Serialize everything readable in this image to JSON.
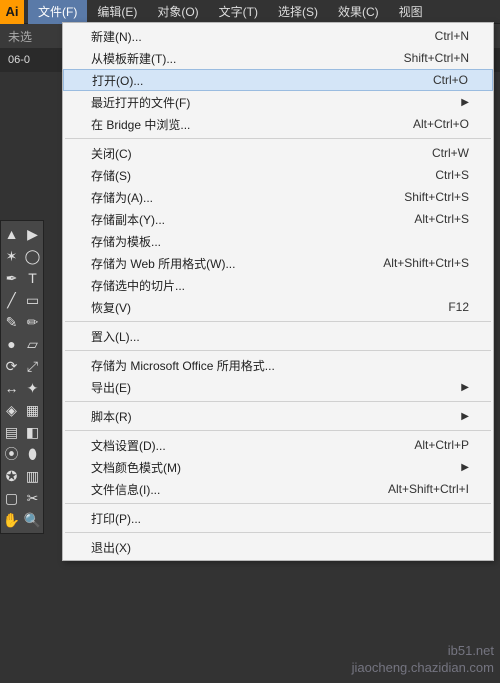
{
  "app_icon": "Ai",
  "menubar": [
    "文件(F)",
    "编辑(E)",
    "对象(O)",
    "文字(T)",
    "选择(S)",
    "效果(C)",
    "视图"
  ],
  "active_menu_index": 0,
  "secondrow": "未选",
  "tab": "06-0",
  "file_menu": [
    {
      "type": "item",
      "label": "新建(N)...",
      "shortcut": "Ctrl+N"
    },
    {
      "type": "item",
      "label": "从模板新建(T)...",
      "shortcut": "Shift+Ctrl+N"
    },
    {
      "type": "item",
      "label": "打开(O)...",
      "shortcut": "Ctrl+O",
      "highlighted": true
    },
    {
      "type": "sub",
      "label": "最近打开的文件(F)"
    },
    {
      "type": "item",
      "label": "在 Bridge 中浏览...",
      "shortcut": "Alt+Ctrl+O"
    },
    {
      "type": "sep"
    },
    {
      "type": "item",
      "label": "关闭(C)",
      "shortcut": "Ctrl+W"
    },
    {
      "type": "item",
      "label": "存储(S)",
      "shortcut": "Ctrl+S"
    },
    {
      "type": "item",
      "label": "存储为(A)...",
      "shortcut": "Shift+Ctrl+S"
    },
    {
      "type": "item",
      "label": "存储副本(Y)...",
      "shortcut": "Alt+Ctrl+S"
    },
    {
      "type": "item",
      "label": "存储为模板..."
    },
    {
      "type": "item",
      "label": "存储为 Web 所用格式(W)...",
      "shortcut": "Alt+Shift+Ctrl+S"
    },
    {
      "type": "item",
      "label": "存储选中的切片..."
    },
    {
      "type": "item",
      "label": "恢复(V)",
      "shortcut": "F12"
    },
    {
      "type": "sep"
    },
    {
      "type": "item",
      "label": "置入(L)..."
    },
    {
      "type": "sep"
    },
    {
      "type": "item",
      "label": "存储为 Microsoft Office 所用格式..."
    },
    {
      "type": "sub",
      "label": "导出(E)"
    },
    {
      "type": "sep"
    },
    {
      "type": "sub",
      "label": "脚本(R)"
    },
    {
      "type": "sep"
    },
    {
      "type": "item",
      "label": "文档设置(D)...",
      "shortcut": "Alt+Ctrl+P"
    },
    {
      "type": "sub",
      "label": "文档颜色模式(M)"
    },
    {
      "type": "item",
      "label": "文件信息(I)...",
      "shortcut": "Alt+Shift+Ctrl+I"
    },
    {
      "type": "sep"
    },
    {
      "type": "item",
      "label": "打印(P)..."
    },
    {
      "type": "sep"
    },
    {
      "type": "item",
      "label": "退出(X)"
    }
  ],
  "tools": [
    [
      "selection",
      "group-select"
    ],
    [
      "magic-wand",
      "lasso"
    ],
    [
      "pen",
      "type"
    ],
    [
      "line",
      "rectangle"
    ],
    [
      "paintbrush",
      "pencil"
    ],
    [
      "blob",
      "eraser"
    ],
    [
      "rotate",
      "scale"
    ],
    [
      "width",
      "warp"
    ],
    [
      "shape-builder",
      "perspective"
    ],
    [
      "mesh",
      "gradient"
    ],
    [
      "eyedropper",
      "blend"
    ],
    [
      "symbol",
      "graph"
    ],
    [
      "artboard",
      "slice"
    ],
    [
      "hand",
      "zoom"
    ]
  ],
  "tool_glyphs": {
    "selection": "▲",
    "group-select": "▶",
    "magic-wand": "✶",
    "lasso": "◯",
    "pen": "✒",
    "type": "T",
    "line": "╱",
    "rectangle": "▭",
    "paintbrush": "✎",
    "pencil": "✏",
    "blob": "●",
    "eraser": "▱",
    "rotate": "⟳",
    "scale": "⤢",
    "width": "↔",
    "warp": "✦",
    "shape-builder": "◈",
    "perspective": "▦",
    "mesh": "▤",
    "gradient": "◧",
    "eyedropper": "⦿",
    "blend": "⬮",
    "symbol": "✪",
    "graph": "▥",
    "artboard": "▢",
    "slice": "✂",
    "hand": "✋",
    "zoom": "🔍"
  },
  "watermark": {
    "line1": "ib51.net",
    "line2": "jiaocheng.chazidian.com"
  }
}
